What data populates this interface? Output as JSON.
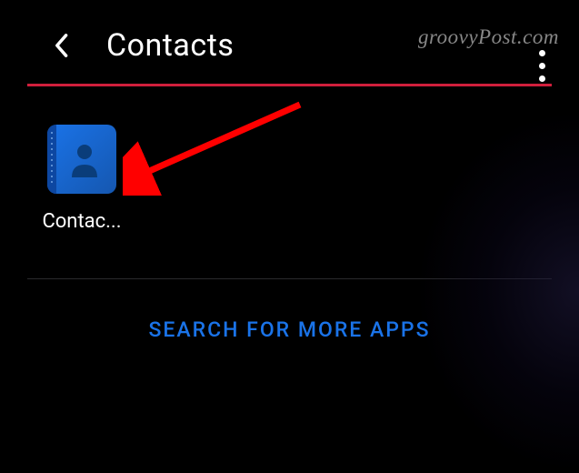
{
  "header": {
    "title": "Contacts"
  },
  "watermark": "groovyPost.com",
  "results": {
    "items": [
      {
        "label": "Contac...",
        "icon": "contacts-icon"
      }
    ]
  },
  "footer": {
    "search_more_label": "SEARCH FOR MORE APPS"
  },
  "colors": {
    "accent_red": "#d01f3c",
    "link_blue": "#1a73e8",
    "icon_blue": "#1a73e8"
  }
}
